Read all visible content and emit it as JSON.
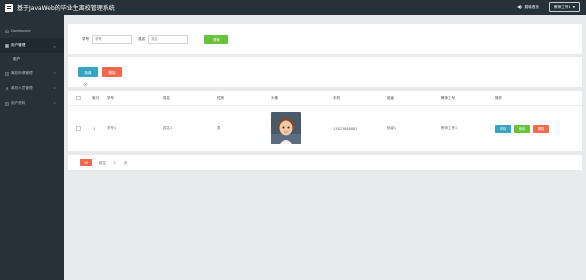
{
  "header": {
    "title": "基于JavaWeb的毕业生离校管理系统",
    "link_label": "跳转首页",
    "user_label": "教师工号1",
    "brand_color": "#263238"
  },
  "sidebar": {
    "items": [
      {
        "label": "Dashboard",
        "icon": "home-icon"
      },
      {
        "label": "用户管理",
        "icon": "grid-icon",
        "active": true,
        "sub": [
          "用户"
        ]
      },
      {
        "label": "离校申请管理",
        "icon": "document-icon"
      },
      {
        "label": "离校人员管理",
        "icon": "people-icon"
      },
      {
        "label": "用户资料",
        "icon": "profile-icon"
      }
    ]
  },
  "search": {
    "field1_label": "学号",
    "field1_placeholder": "学号",
    "field2_label": "姓名",
    "field2_placeholder": "姓名",
    "button_label": "搜索"
  },
  "actions": {
    "add_label": "新增",
    "delete_label": "删除"
  },
  "table": {
    "columns": [
      "索引",
      "学号",
      "姓名",
      "性别",
      "头像",
      "手机",
      "班级",
      "教师工号",
      "操作"
    ],
    "rows": [
      {
        "index": "1",
        "student_no": "学号1",
        "name": "姓名1",
        "gender": "男",
        "phone": "13823888881",
        "class_name": "班级1",
        "teacher_no": "教师工号1",
        "ops": [
          "详情",
          "修改",
          "删除"
        ]
      }
    ]
  },
  "pagination": {
    "page_size": "10",
    "prev": "前往",
    "current_page": "1",
    "unit": "页"
  }
}
